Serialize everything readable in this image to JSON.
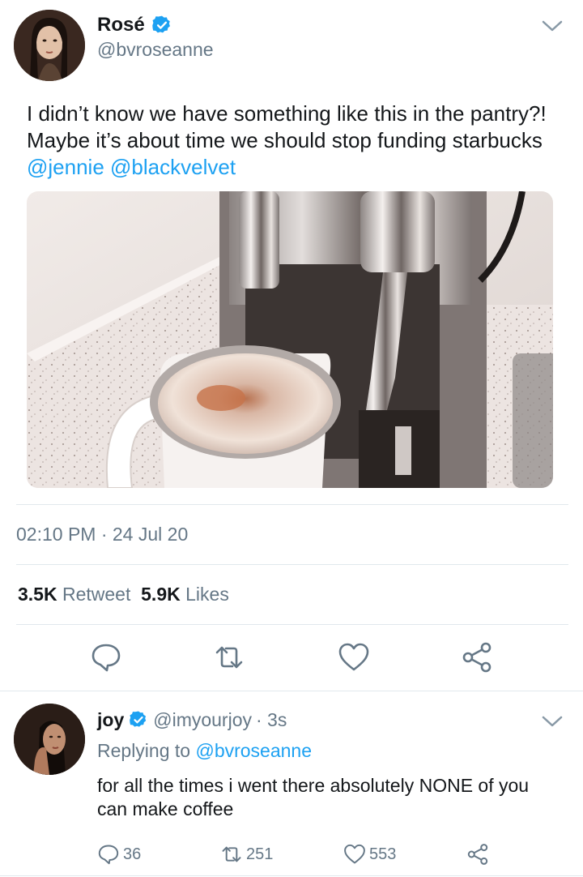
{
  "tweet": {
    "author": {
      "name": "Rosé",
      "handle": "@bvroseanne",
      "verified": true
    },
    "text_prefix": "I didn’t know we have something like this in the pantry?! Maybe it’s about time we should stop funding starbucks ",
    "mentions": [
      "@jennie",
      "@blackvelvet"
    ],
    "photo_description_icon": "coffee-machine-photo",
    "timestamp": "02:10 PM · 24 Jul 20",
    "stats": {
      "retweets_count": "3.5K",
      "retweets_label": "Retweet",
      "likes_count": "5.9K",
      "likes_label": "Likes"
    },
    "actions": [
      "reply-icon",
      "retweet-icon",
      "like-icon",
      "share-icon"
    ]
  },
  "reply": {
    "author": {
      "name": "joy",
      "handle": "@imyourjoy",
      "time": "· 3s",
      "verified": true
    },
    "replying_prefix": "Replying to ",
    "replying_to": "@bvroseanne",
    "text": "for all the times i went there absolutely NONE of you can make coffee",
    "counts": {
      "replies": "36",
      "retweets": "251",
      "likes": "553"
    }
  },
  "colors": {
    "accent": "#1da1f2",
    "secondary_text": "#657786",
    "primary_text": "#14171a",
    "divider": "#e1e8ed"
  }
}
